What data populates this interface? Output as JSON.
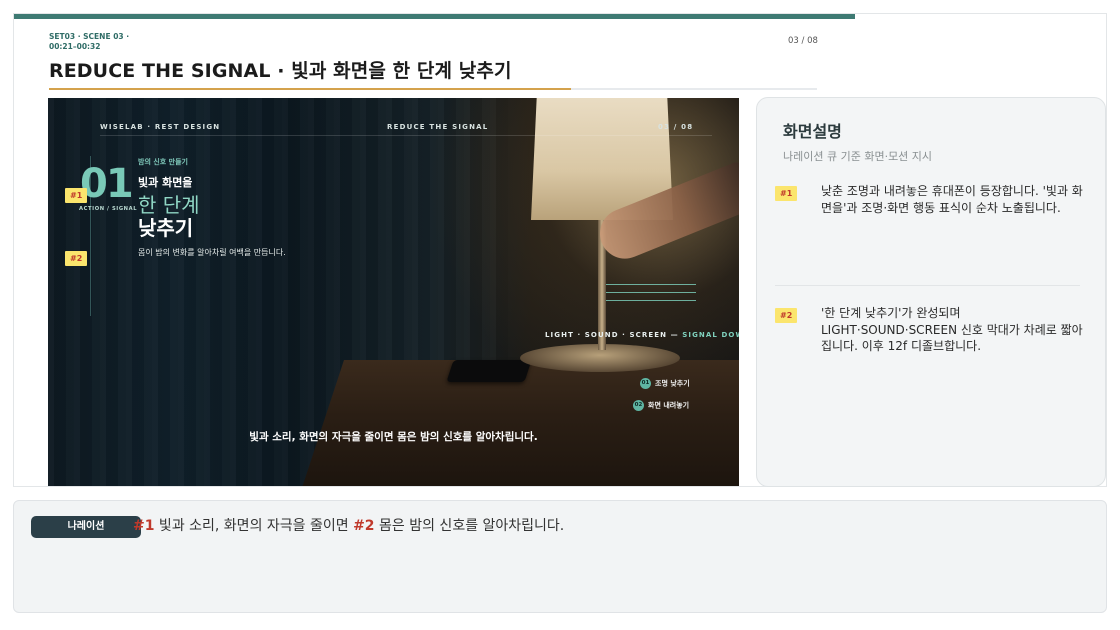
{
  "header": {
    "meta": "SET03 · SCENE 03 ·\n00:21–00:32",
    "page": "03 / 08",
    "title": "REDUCE THE SIGNAL · 빛과 화면을 한 단계 낮추기"
  },
  "frame": {
    "brand": "WISELAB · REST DESIGN",
    "mid_label": "REDUCE THE SIGNAL",
    "page": "03 / 08",
    "kicker": "밤의 신호 만들기",
    "number": "01",
    "number_sub": "ACTION / SIGNAL",
    "line1": "빛과 화면을",
    "line2": "한 단계",
    "line3": "낮추기",
    "desc": "몸이 밤의 변화를 알아차릴 여백을 만듭니다.",
    "signal_prefix": "LIGHT · SOUND · SCREEN — ",
    "signal_suffix": "SIGNAL DOWN",
    "legend1_num": "01",
    "legend1": "조명 낮추기",
    "legend2_num": "02",
    "legend2": "화면 내려놓기",
    "subtitle": "빛과 소리, 화면의 자극을 줄이면 몸은 밤의 신호를 알아차립니다.",
    "marker1": "#1",
    "marker2": "#2"
  },
  "panel": {
    "title": "화면설명",
    "subtitle": "나레이션 큐 기준 화면·모션 지시",
    "items": [
      {
        "tag": "#1",
        "text": "낮춘 조명과 내려놓은 휴대폰이 등장합니다. '빛과 화면을'과 조명·화면 행동 표식이 순차 노출됩니다."
      },
      {
        "tag": "#2",
        "text": "'한 단계 낮추기'가 완성되며 LIGHT·SOUND·SCREEN 신호 막대가 차례로 짧아집니다. 이후 12f 디졸브합니다."
      }
    ]
  },
  "narration": {
    "badge": "나레이션",
    "marker1": "#1",
    "text1": " 빛과 소리, 화면의 자극을 줄이면 ",
    "marker2": "#2",
    "text2": " 몸은 밤의 신호를 알아차립니다."
  },
  "colors": {
    "accent": "#3e7a73",
    "gold": "#d4a24c",
    "marker_bg": "#fbe56d",
    "marker_text": "#c0392b",
    "badge_bg": "#2b3f48"
  }
}
